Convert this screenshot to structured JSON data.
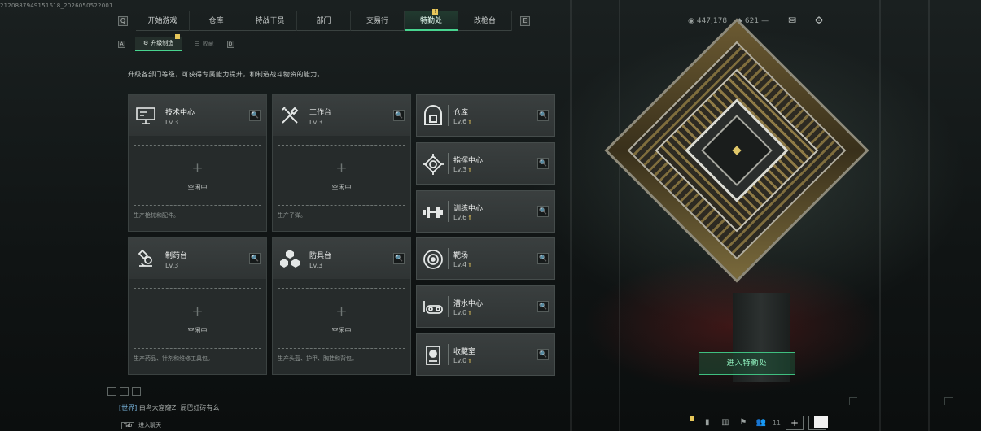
{
  "debug_id": "2120887949151618_2026050522001",
  "nav": {
    "left_arrow": "Q",
    "right_arrow": "E",
    "tabs": [
      {
        "label": "开始游戏"
      },
      {
        "label": "仓库"
      },
      {
        "label": "特战干员"
      },
      {
        "label": "部门"
      },
      {
        "label": "交易行"
      },
      {
        "label": "特勤处",
        "badge": "!"
      },
      {
        "label": "改枪台"
      }
    ],
    "active_tab": "特勤处"
  },
  "subnav": {
    "left_arrow": "A",
    "right_arrow": "D",
    "tabs": [
      {
        "label": "升级制造",
        "badge": "!"
      },
      {
        "label": "收藏"
      }
    ]
  },
  "header": {
    "currency1": "447,178",
    "currency2": "621",
    "mail_icon": "mail-icon",
    "settings_icon": "gear-icon"
  },
  "hint": "升级各部门等级，可获得专属能力提升，和制造战斗物资的能力。",
  "craft_cards": [
    {
      "name": "技术中心",
      "level": "Lv.3",
      "icon": "monitor-icon",
      "slot": "空闲中",
      "desc": "生产枪械和配件。"
    },
    {
      "name": "工作台",
      "level": "Lv.3",
      "icon": "tools-icon",
      "slot": "空闲中",
      "desc": "生产子弹。"
    },
    {
      "name": "制药台",
      "level": "Lv.3",
      "icon": "microscope-icon",
      "slot": "空闲中",
      "desc": "生产药品、针剂和维修工具包。"
    },
    {
      "name": "防具台",
      "level": "Lv.3",
      "icon": "armor-icon",
      "slot": "空闲中",
      "desc": "生产头盔、护甲、胸挂和背包。"
    }
  ],
  "side_cards": [
    {
      "name": "仓库",
      "level": "Lv.6",
      "icon": "warehouse-icon"
    },
    {
      "name": "指挥中心",
      "level": "Lv.3",
      "icon": "command-icon"
    },
    {
      "name": "训练中心",
      "level": "Lv.6",
      "icon": "dumbbell-icon"
    },
    {
      "name": "靶场",
      "level": "Lv.4",
      "icon": "target-icon"
    },
    {
      "name": "潜水中心",
      "level": "Lv.0",
      "icon": "dive-icon"
    },
    {
      "name": "收藏室",
      "level": "Lv.0",
      "icon": "collection-icon"
    }
  ],
  "enter_button": "进入特勤处",
  "chat": {
    "channel": "[世界]",
    "message": "白鸟大窟窿Z: 屁巴红砖有么",
    "tab_key": "Tab",
    "tab_hint": "进入聊天"
  },
  "bottom": {
    "friends_count": "11"
  },
  "colors": {
    "accent_green": "#48d48f",
    "badge_yellow": "#e7c75a"
  }
}
